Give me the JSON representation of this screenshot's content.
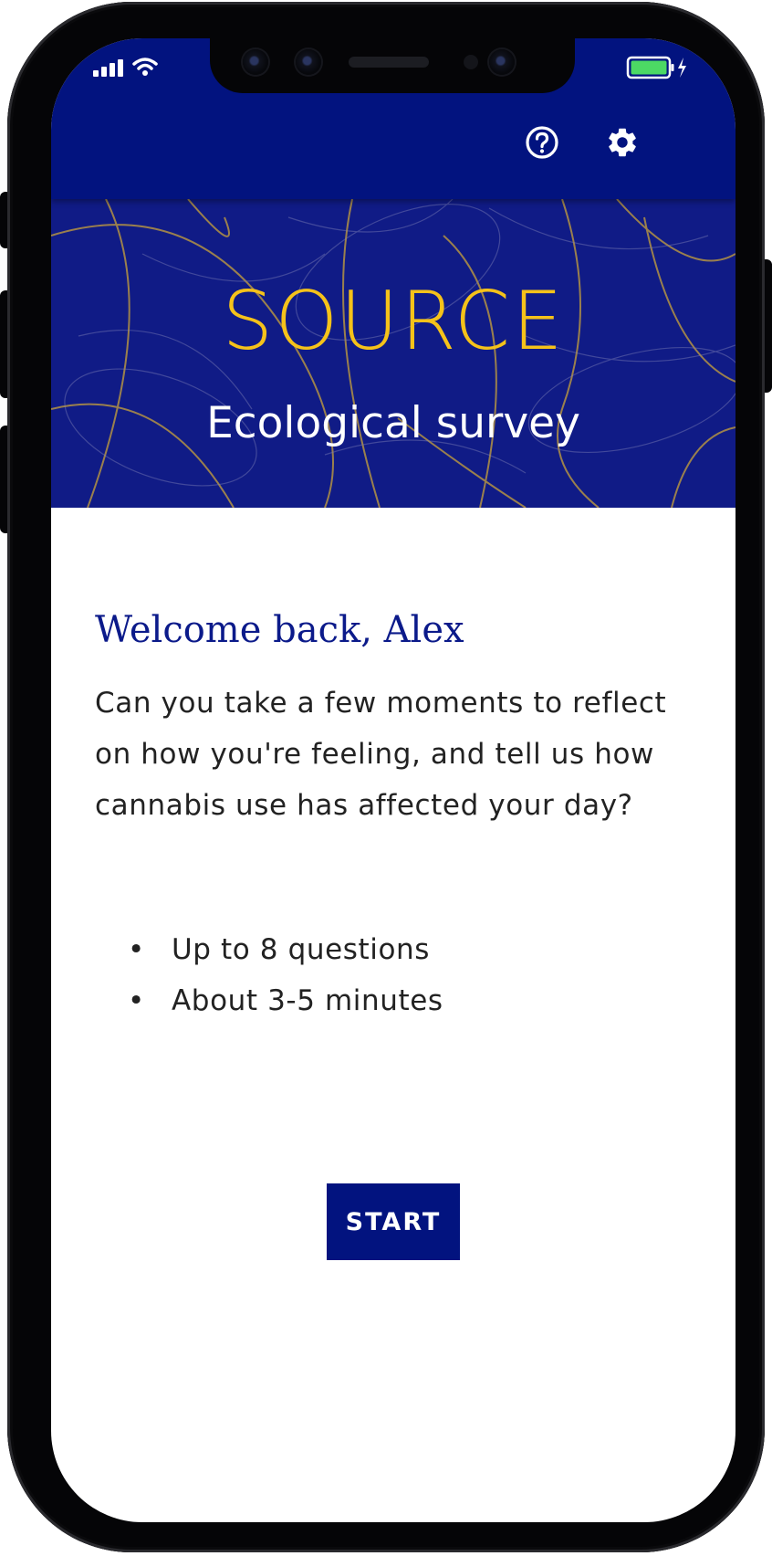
{
  "status_bar": {
    "signal_icon": "signal-bars-icon",
    "wifi_icon": "wifi-icon",
    "battery_icon": "battery-charging-icon"
  },
  "app_bar": {
    "help_icon": "help-circle-icon",
    "settings_icon": "gear-icon",
    "background_color": "#02137f"
  },
  "hero": {
    "brand": "SOURCE",
    "subtitle": "Ecological survey",
    "brand_color": "#f5c21a"
  },
  "main": {
    "greeting": "Welcome back, Alex",
    "intro": "Can you take a few moments to reflect on how you're feeling, and tell us how cannabis use has affected your day?",
    "bullet_symbol": "•",
    "details": [
      "Up to 8 questions",
      "About 3-5 minutes"
    ],
    "start_label": "START",
    "accent_color": "#02137f"
  }
}
